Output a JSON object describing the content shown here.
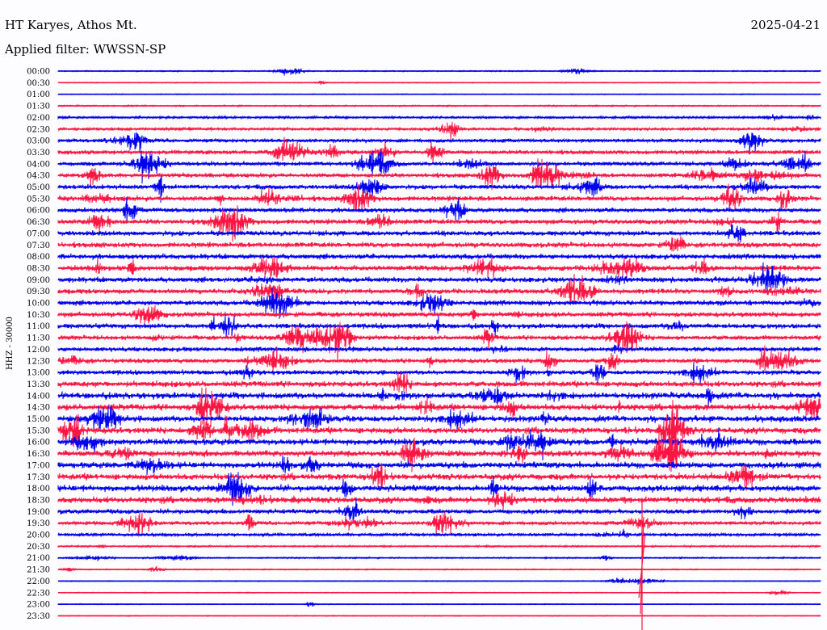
{
  "header": {
    "station": "HT Karyes, Athos Mt.",
    "date": "2025-04-21",
    "filter": "Applied filter: WWSSN-SP"
  },
  "colors": {
    "background": "#fdfdff",
    "trace_a": "#0000ee",
    "trace_b": "#ff1744",
    "text": "#000000"
  },
  "chart_data": {
    "type": "line",
    "description_of_traces": "helicorder",
    "ylabel": "HHZ - 30000",
    "row_labels": [
      "00:00",
      "00:30",
      "01:00",
      "01:30",
      "02:00",
      "02:30",
      "03:00",
      "03:30",
      "04:00",
      "04:30",
      "05:00",
      "05:30",
      "06:00",
      "06:30",
      "07:00",
      "07:30",
      "08:00",
      "08:30",
      "09:00",
      "09:30",
      "10:00",
      "10:30",
      "11:00",
      "11:30",
      "12:00",
      "12:30",
      "13:00",
      "13:30",
      "14:00",
      "14:30",
      "15:00",
      "15:30",
      "16:00",
      "16:30",
      "17:00",
      "17:30",
      "18:00",
      "18:30",
      "19:00",
      "19:30",
      "20:00",
      "20:30",
      "21:00",
      "21:30",
      "22:00",
      "22:30",
      "23:00",
      "23:30"
    ],
    "row_colors": [
      "blue",
      "red"
    ],
    "relative_amplitude": [
      0.4,
      0.3,
      0.3,
      0.5,
      0.9,
      1.2,
      1.6,
      1.8,
      1.8,
      1.9,
      2.0,
      2.2,
      2.1,
      2.2,
      2.2,
      2.3,
      2.3,
      2.3,
      2.3,
      2.2,
      2.2,
      2.2,
      2.2,
      2.0,
      2.0,
      2.0,
      2.0,
      2.6,
      2.8,
      2.8,
      2.8,
      2.8,
      2.8,
      2.8,
      2.8,
      2.8,
      2.8,
      2.8,
      2.0,
      1.6,
      1.4,
      0.6,
      0.5,
      0.4,
      0.3,
      0.3,
      0.3,
      0.3
    ]
  }
}
